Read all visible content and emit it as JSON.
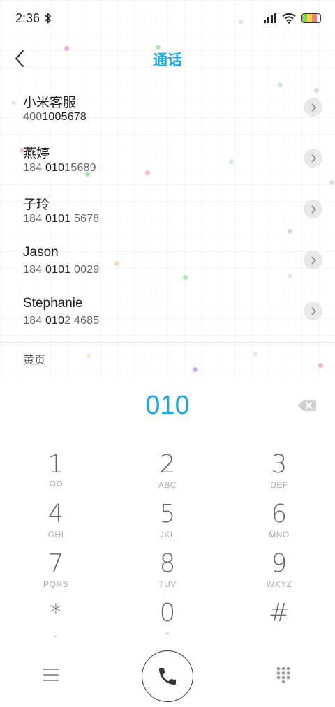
{
  "status": {
    "time": "2:36",
    "bluetooth_icon": "bluetooth-icon",
    "signal_icon": "signal-icon",
    "wifi_icon": "wifi-icon",
    "battery_icon": "battery-icon"
  },
  "header": {
    "title": "通话",
    "back_icon": "chevron-left-icon"
  },
  "contacts": [
    {
      "name": "小米客服",
      "number_pre": "400",
      "number_match": "1005678",
      "number_post": ""
    },
    {
      "name": "燕婷",
      "number_pre": "184 ",
      "number_match": "010",
      "number_post": "15689"
    },
    {
      "name": "子玲",
      "number_pre": "184 ",
      "number_match": "0101",
      "number_post": " 5678"
    },
    {
      "name": "Jason",
      "number_pre": "184 ",
      "number_match": "0101",
      "number_post": " 0029"
    },
    {
      "name": "Stephanie",
      "number_pre": "184 ",
      "number_match": "010",
      "number_post": "2 4685"
    }
  ],
  "yellow_pages": "黄页",
  "dialer": {
    "number": "010",
    "delete_icon": "backspace-icon"
  },
  "keypad": [
    {
      "digit": "1",
      "letters": ""
    },
    {
      "digit": "2",
      "letters": "ABC"
    },
    {
      "digit": "3",
      "letters": "DEF"
    },
    {
      "digit": "4",
      "letters": "GHI"
    },
    {
      "digit": "5",
      "letters": "JKL"
    },
    {
      "digit": "6",
      "letters": "MNO"
    },
    {
      "digit": "7",
      "letters": "PQRS"
    },
    {
      "digit": "8",
      "letters": "TUV"
    },
    {
      "digit": "9",
      "letters": "WXYZ"
    },
    {
      "digit": "*",
      "letters": ","
    },
    {
      "digit": "0",
      "letters": "+"
    },
    {
      "digit": "#",
      "letters": ""
    }
  ],
  "bottom": {
    "menu_icon": "menu-icon",
    "call_icon": "phone-icon",
    "keypad_icon": "dialpad-icon"
  },
  "colors": {
    "accent": "#1aa6e4",
    "chevron_bg": "#e9e9e9"
  }
}
